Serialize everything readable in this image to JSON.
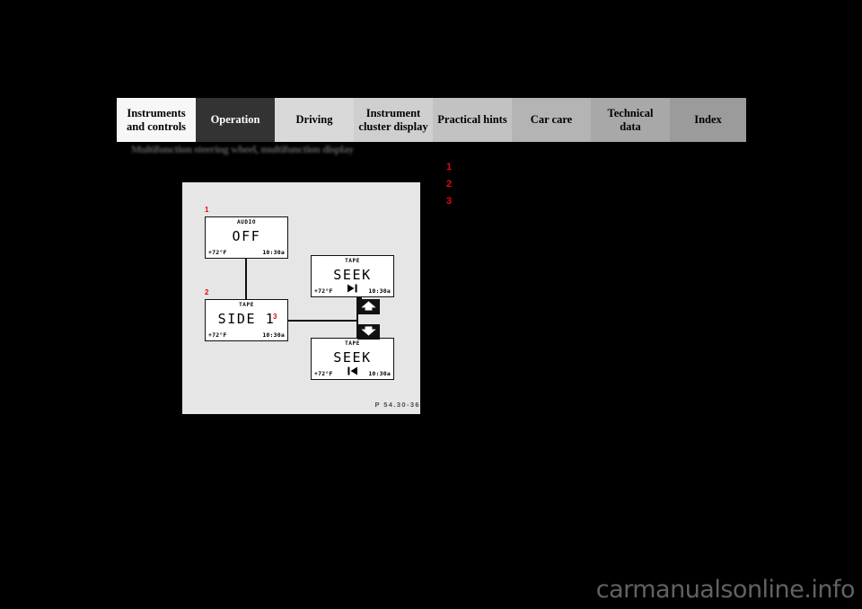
{
  "page": {
    "background_color": "#000000",
    "section_heading": "Multifunction steering wheel, multifunction display",
    "watermark": "carmanualsonline.info"
  },
  "tabbar": {
    "active_tab": "Operation",
    "tabs": [
      {
        "label": "Instruments\nand controls",
        "color": "#f7f7f7",
        "active": false
      },
      {
        "label": "Operation",
        "color": "#333333",
        "active": true
      },
      {
        "label": "Driving",
        "color": "#d9d9d9",
        "active": false
      },
      {
        "label": "Instrument\ncluster display",
        "color": "#cfcfcf",
        "active": false
      },
      {
        "label": "Practical hints",
        "color": "#c2c2c2",
        "active": false
      },
      {
        "label": "Car care",
        "color": "#b4b4b4",
        "active": false
      },
      {
        "label": "Technical\ndata",
        "color": "#a8a8a8",
        "active": false
      },
      {
        "label": "Index",
        "color": "#9b9b9b",
        "active": false
      }
    ]
  },
  "figure": {
    "caption": "P 54.30-36",
    "background_color": "#e6e6e6",
    "callout_color": "#e40613",
    "callouts": {
      "one": "1",
      "two": "2",
      "three": "3"
    },
    "displays": [
      {
        "id": "audio-off",
        "header": "AUDIO",
        "main": "OFF",
        "bottom_left": "+72°F",
        "bottom_right": "10:30a",
        "bottom_center_icon": ""
      },
      {
        "id": "tape-side-1",
        "header": "TAPE",
        "main": "SIDE 1",
        "bottom_left": "+72°F",
        "bottom_right": "10:30a",
        "bottom_center_icon": ""
      },
      {
        "id": "seek-forward",
        "header": "TAPE",
        "main": "SEEK",
        "bottom_left": "+72°F",
        "bottom_right": "10:30a",
        "bottom_center_icon": "seek-forward-icon"
      },
      {
        "id": "seek-reverse",
        "header": "TAPE",
        "main": "SEEK",
        "bottom_left": "+72°F",
        "bottom_right": "10:30a",
        "bottom_center_icon": "seek-reverse-icon"
      }
    ],
    "rockers": [
      {
        "id": "rocker-up",
        "icon": "arrow-up-icon"
      },
      {
        "id": "rocker-down",
        "icon": "arrow-down-icon"
      }
    ]
  },
  "right_column": {
    "items": [
      {
        "number": "1",
        "text": ""
      },
      {
        "number": "2",
        "text": ""
      },
      {
        "number": "3",
        "text": ""
      }
    ]
  }
}
